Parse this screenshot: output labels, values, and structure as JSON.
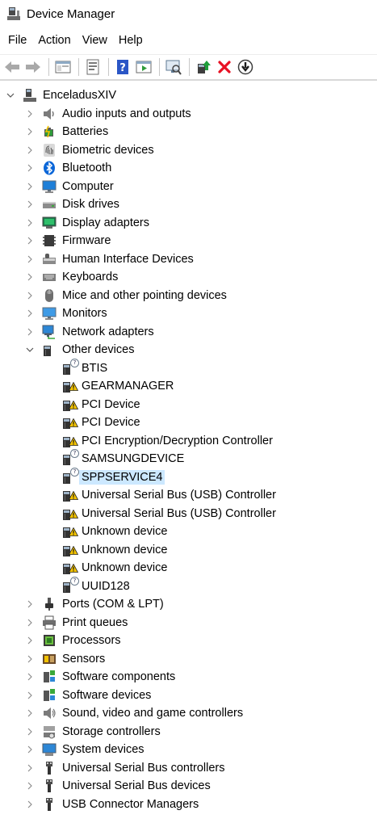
{
  "window": {
    "title": "Device Manager"
  },
  "menu": [
    "File",
    "Action",
    "View",
    "Help"
  ],
  "toolbar": {
    "buttons": [
      "back-icon",
      "forward-icon",
      "properties-pane-icon",
      "list-view-icon",
      "help-icon",
      "console-tree-icon",
      "scan-hardware-icon",
      "update-driver-icon",
      "uninstall-icon",
      "disable-icon"
    ]
  },
  "tree": {
    "root": "EnceladusXIV",
    "categories": [
      "Audio inputs and outputs",
      "Batteries",
      "Biometric devices",
      "Bluetooth",
      "Computer",
      "Disk drives",
      "Display adapters",
      "Firmware",
      "Human Interface Devices",
      "Keyboards",
      "Mice and other pointing devices",
      "Monitors",
      "Network adapters",
      "Other devices"
    ],
    "other_devices": [
      {
        "label": "BTIS",
        "status": "unknown"
      },
      {
        "label": "GEARMANAGER",
        "status": "warning"
      },
      {
        "label": "PCI Device",
        "status": "warning"
      },
      {
        "label": "PCI Device",
        "status": "warning"
      },
      {
        "label": "PCI Encryption/Decryption Controller",
        "status": "warning"
      },
      {
        "label": "SAMSUNGDEVICE",
        "status": "unknown"
      },
      {
        "label": "SPPSERVICE4",
        "status": "unknown",
        "selected": true
      },
      {
        "label": "Universal Serial Bus (USB) Controller",
        "status": "warning"
      },
      {
        "label": "Universal Serial Bus (USB) Controller",
        "status": "warning"
      },
      {
        "label": "Unknown device",
        "status": "warning"
      },
      {
        "label": "Unknown device",
        "status": "warning"
      },
      {
        "label": "Unknown device",
        "status": "warning"
      },
      {
        "label": "UUID128",
        "status": "unknown"
      }
    ],
    "categories_after": [
      "Ports (COM & LPT)",
      "Print queues",
      "Processors",
      "Sensors",
      "Software components",
      "Software devices",
      "Sound, video and game controllers",
      "Storage controllers",
      "System devices",
      "Universal Serial Bus controllers",
      "Universal Serial Bus devices",
      "USB Connector Managers"
    ]
  },
  "colors": {
    "selection": "#cce8ff",
    "warning": "#f5c400",
    "error": "#e81123"
  }
}
